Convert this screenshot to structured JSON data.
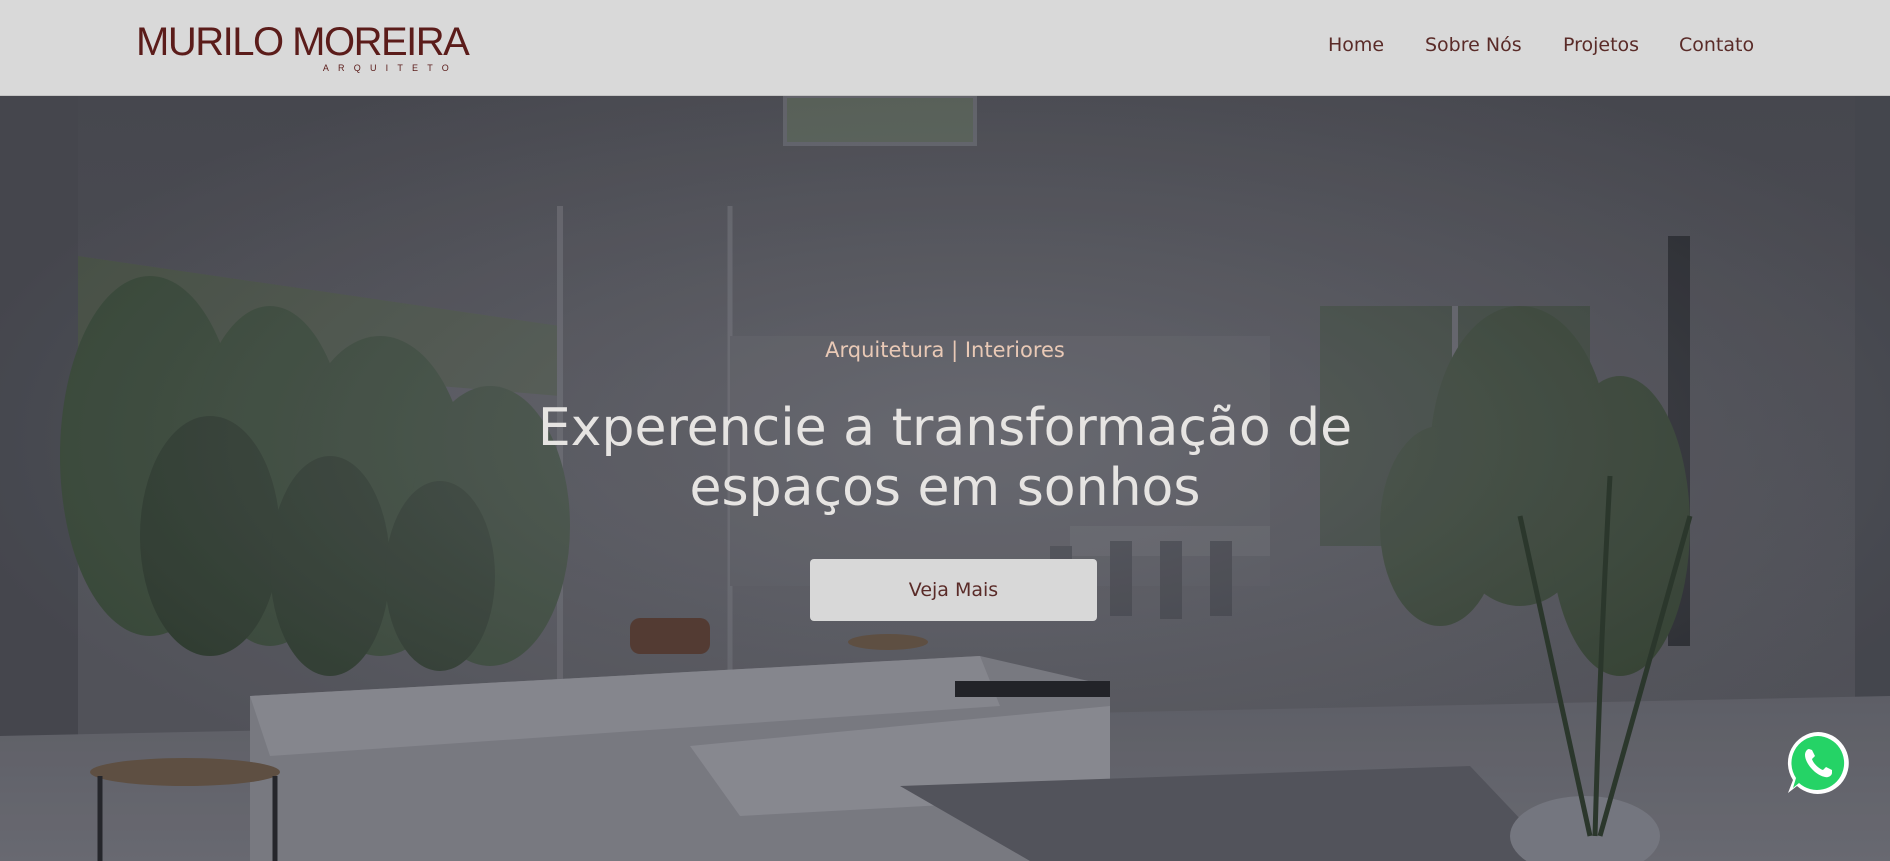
{
  "brand": {
    "name": "MURILO MOREIRA",
    "tagline": "ARQUITETO",
    "color": "#5b1c1a"
  },
  "nav": {
    "items": [
      {
        "label": "Home"
      },
      {
        "label": "Sobre Nós"
      },
      {
        "label": "Projetos"
      },
      {
        "label": "Contato"
      }
    ]
  },
  "hero": {
    "eyebrow": "Arquitetura | Interiores",
    "title": "Experencie a transformação de espaços em sonhos",
    "button_label": "Veja Mais",
    "image": "living-room-interior-render"
  },
  "whatsapp": {
    "icon": "whatsapp-icon",
    "color": "#25d366"
  },
  "colors": {
    "header_bg": "#d9d9d9",
    "accent_text": "#5a2b28",
    "eyebrow_text": "#e9c9b6",
    "hero_text": "#e6e4e2",
    "button_bg": "#d8d8d8"
  }
}
